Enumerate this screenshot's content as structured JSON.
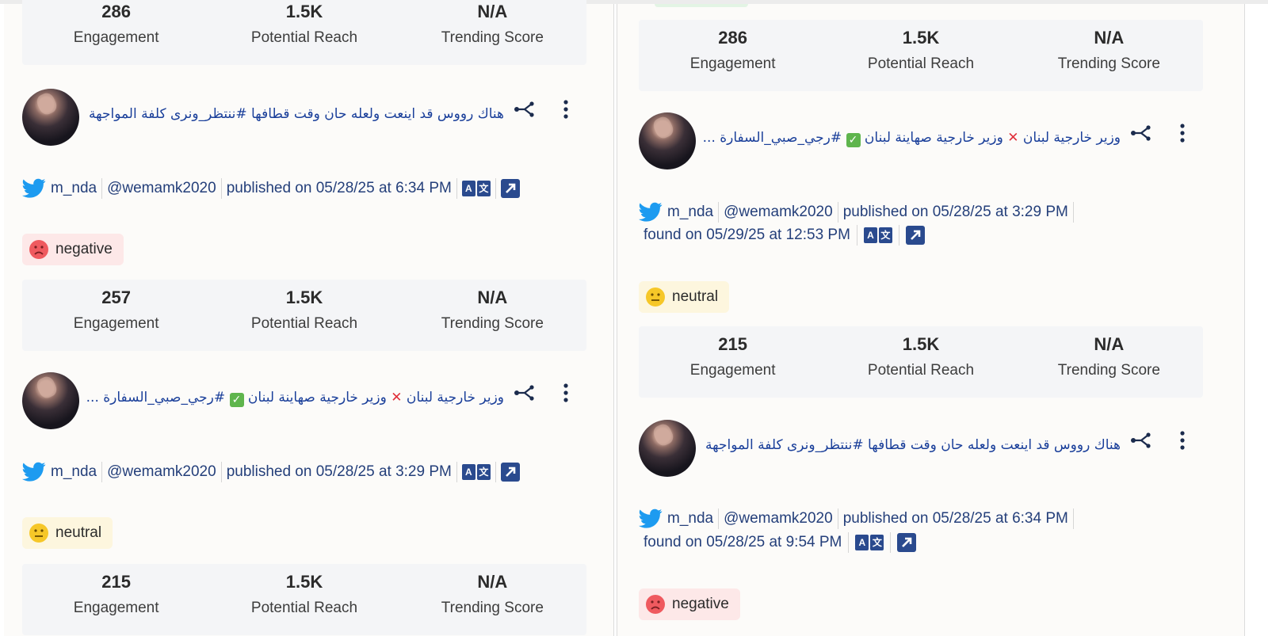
{
  "colors": {
    "link_text": "#1a3f9a",
    "meta_text": "#243f7a",
    "negative_badge_bg": "#fde8e8",
    "neutral_badge_bg": "#fdf6de",
    "stats_bg": "#f4f5f7",
    "twitter_blue": "#1d9bf0"
  },
  "left_column": {
    "stats_1": {
      "engagement": "286",
      "reach": "1.5K",
      "trending": "N/A"
    },
    "post_1": {
      "text": "هناك رووس قد اينعت ولعله حان وقت قطافها #ننتظر_ونرى كلفة المواجهة اقل بـ...",
      "author": "m_nda",
      "handle": "@wemamk2020",
      "published": "published on 05/28/25 at 6:34 PM",
      "sentiment": "negative"
    },
    "stats_2": {
      "engagement": "257",
      "reach": "1.5K",
      "trending": "N/A"
    },
    "post_2": {
      "text_part1": "وزير خارجية لبنان",
      "text_part2": "وزير خارجية صهاينة لبنان",
      "text_part3": "#رجي_صبي_السفارة ...",
      "author": "m_nda",
      "handle": "@wemamk2020",
      "published": "published on 05/28/25 at 3:29 PM",
      "sentiment": "neutral"
    },
    "stats_3": {
      "engagement": "215",
      "reach": "1.5K",
      "trending": "N/A"
    }
  },
  "right_column": {
    "stats_1": {
      "engagement": "286",
      "reach": "1.5K",
      "trending": "N/A"
    },
    "post_1": {
      "text_part1": "وزير خارجية لبنان",
      "text_part2": "وزير خارجية صهاينة لبنان",
      "text_part3": "#رجي_صبي_السفارة ...",
      "author": "m_nda",
      "handle": "@wemamk2020",
      "published": "published on 05/28/25 at 3:29 PM",
      "found": "found on 05/29/25 at 12:53 PM",
      "sentiment": "neutral"
    },
    "stats_2": {
      "engagement": "215",
      "reach": "1.5K",
      "trending": "N/A"
    },
    "post_2": {
      "text": "هناك رووس قد اينعت ولعله حان وقت قطافها #ننتظر_ونرى كلفة المواجهة اقل بـ...",
      "author": "m_nda",
      "handle": "@wemamk2020",
      "published": "published on 05/28/25 at 6:34 PM",
      "found": "found on 05/28/25 at 9:54 PM",
      "sentiment": "negative"
    }
  },
  "labels": {
    "engagement": "Engagement",
    "reach": "Potential Reach",
    "trending": "Trending Score",
    "translate_a": "A",
    "translate_b": "文",
    "check": "✓",
    "x": "✕"
  }
}
